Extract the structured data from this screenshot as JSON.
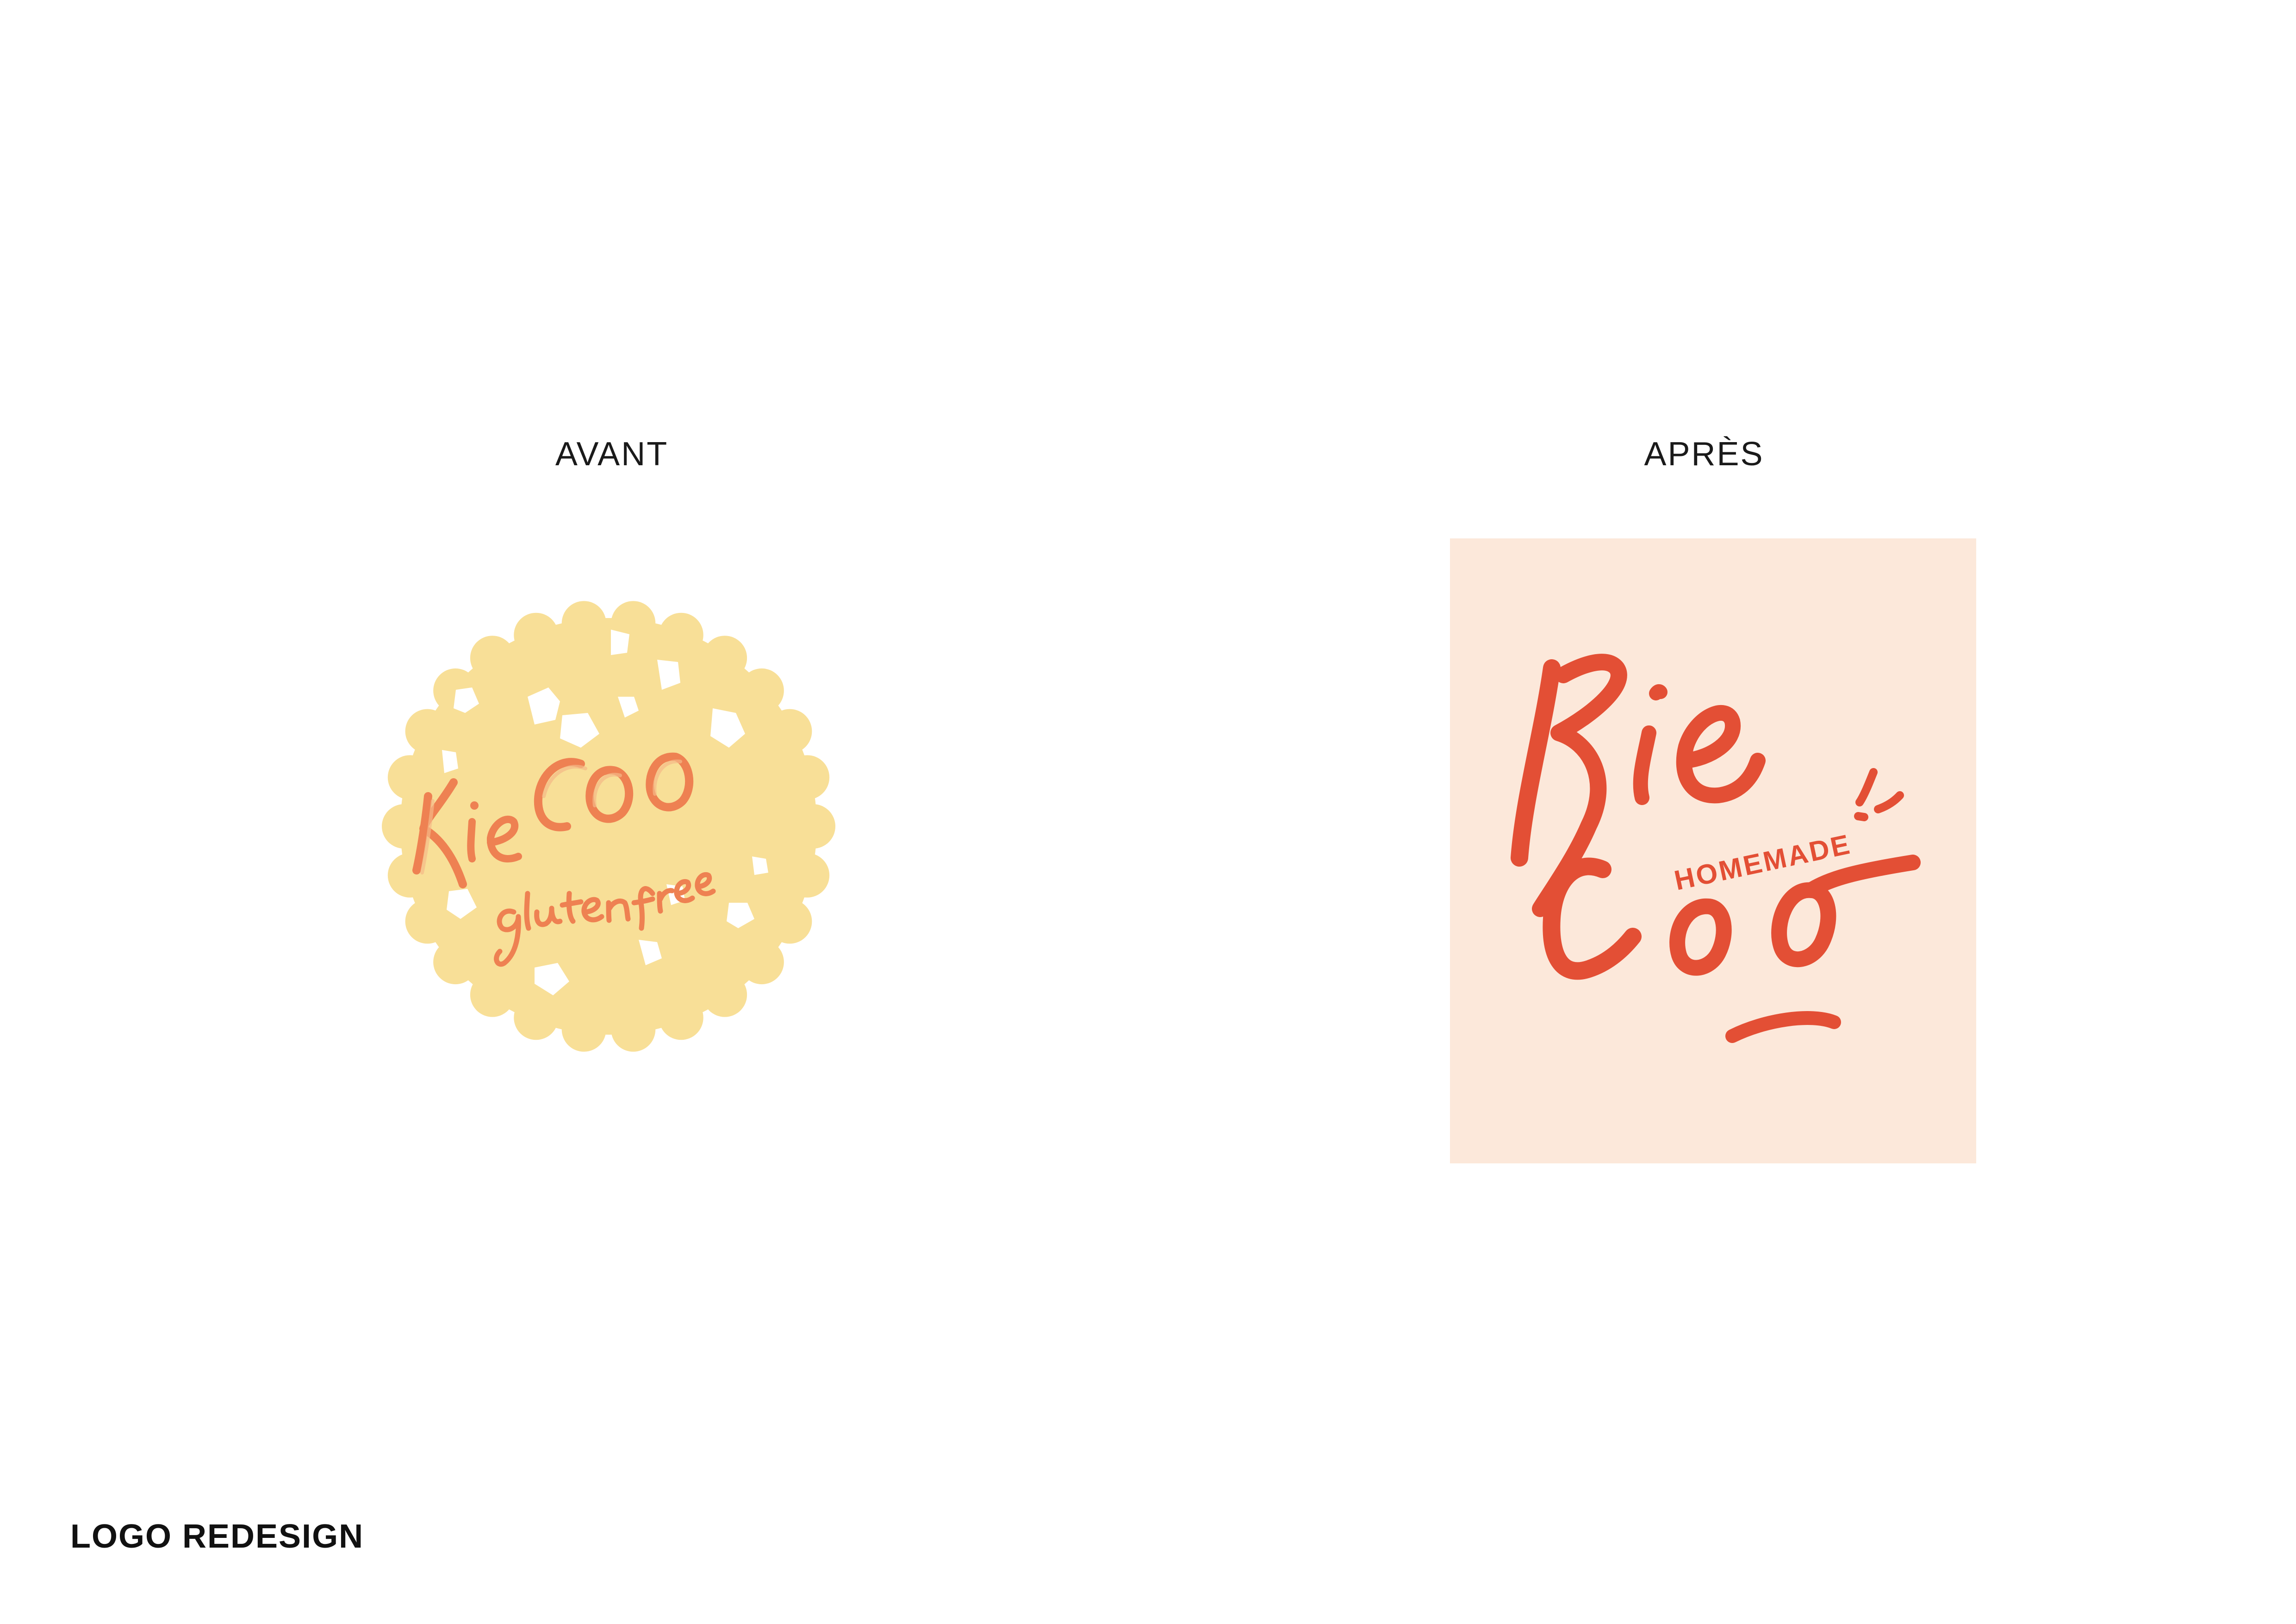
{
  "headings": {
    "before": "AVANT",
    "after": "APRÈS"
  },
  "old_logo": {
    "wordmark": "Kie COO",
    "tagline": "gluten free",
    "colors": {
      "cookie": "#f8df97",
      "chips": "#ffffff",
      "lettering": "#ee8152"
    }
  },
  "new_logo": {
    "wordmark_top": "Kie",
    "wordmark_bottom": "Coo",
    "tagline": "HOMEMADE",
    "colors": {
      "background": "#fce8da",
      "lettering": "#e34f35"
    }
  },
  "footer": {
    "title": "LOGO REDESIGN"
  }
}
